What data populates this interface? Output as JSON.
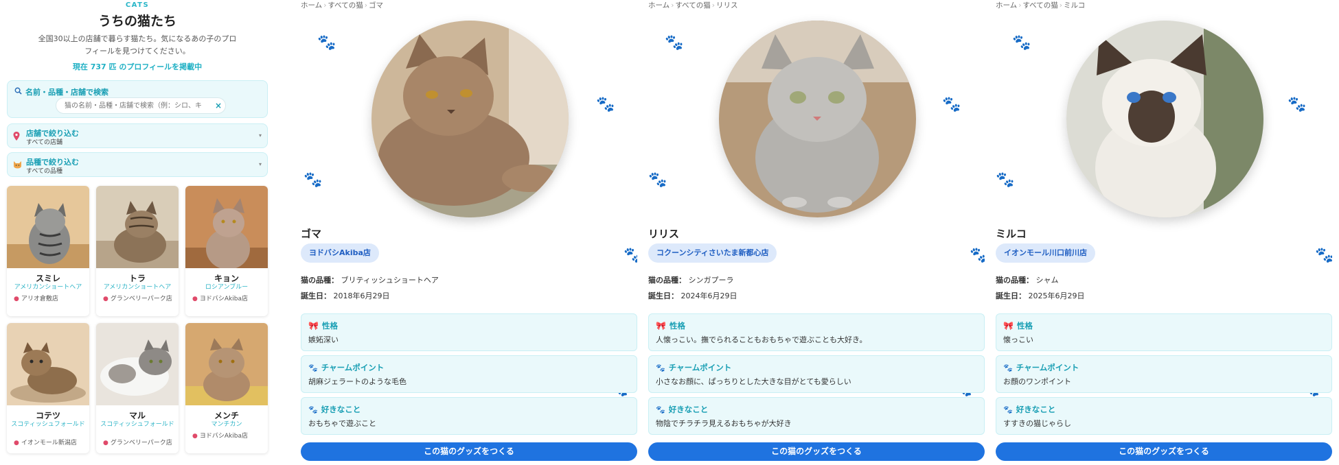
{
  "list": {
    "eyebrow": "CATS",
    "title": "うちの猫たち",
    "description": "全国30以上の店舗で暮らす猫たち。気になるあの子のプロフィールを見つけてください。",
    "count_text": "現在 737 匹 のプロフィールを掲載中",
    "search": {
      "label": "名前・品種・店舗で検索",
      "placeholder": "猫の名前・品種・店舗で検索（例：シロ、キ"
    },
    "store_filter": {
      "label": "店舗で絞り込む",
      "value": "すべての店舗"
    },
    "breed_filter": {
      "label": "品種で絞り込む",
      "value": "すべての品種"
    },
    "cats": [
      {
        "name": "スミレ",
        "breed": "アメリカンショートヘア",
        "store": "アリオ倉敷店"
      },
      {
        "name": "トラ",
        "breed": "アメリカンショートヘア",
        "store": "グランベリーパーク店"
      },
      {
        "name": "キョン",
        "breed": "ロシアンブルー",
        "store": "ヨドバシAkiba店"
      },
      {
        "name": "コテツ",
        "breed": "スコティッシュフォールド",
        "store": "イオンモール新潟店"
      },
      {
        "name": "マル",
        "breed": "スコティッシュフォールド",
        "store": "グランベリーパーク店"
      },
      {
        "name": "メンチ",
        "breed": "マンチカン",
        "store": "ヨドバシAkiba店"
      }
    ]
  },
  "details": [
    {
      "breadcrumb": [
        "ホーム",
        "すべての猫",
        "ゴマ"
      ],
      "name": "ゴマ",
      "store": "ヨドバシAkiba店",
      "breed_label": "猫の品種：",
      "breed": "ブリティッシュショートヘア",
      "birthday_label": "誕生日：",
      "birthday": "2018年6月29日",
      "personality_title": "性格",
      "personality": "嫉妬深い",
      "charm_title": "チャームポイント",
      "charm": "胡麻ジェラートのような毛色",
      "likes_title": "好きなこと",
      "likes": "おもちゃで遊ぶこと",
      "button": "この猫のグッズをつくる"
    },
    {
      "breadcrumb": [
        "ホーム",
        "すべての猫",
        "リリス"
      ],
      "name": "リリス",
      "store": "コクーンシティさいたま新都心店",
      "breed_label": "猫の品種：",
      "breed": "シンガプーラ",
      "birthday_label": "誕生日：",
      "birthday": "2024年6月29日",
      "personality_title": "性格",
      "personality": "人懐っこい。撫でられることもおもちゃで遊ぶことも大好き。",
      "charm_title": "チャームポイント",
      "charm": "小さなお顔に、ぱっちりとした大きな目がとても愛らしい",
      "likes_title": "好きなこと",
      "likes": "物陰でチラチラ見えるおもちゃが大好き",
      "button": "この猫のグッズをつくる"
    },
    {
      "breadcrumb": [
        "ホーム",
        "すべての猫",
        "ミルコ"
      ],
      "name": "ミルコ",
      "store": "イオンモール川口前川店",
      "breed_label": "猫の品種：",
      "breed": "シャム",
      "birthday_label": "誕生日：",
      "birthday": "2025年6月29日",
      "personality_title": "性格",
      "personality": "懐っこい",
      "charm_title": "チャームポイント",
      "charm": "お顔のワンポイント",
      "likes_title": "好きなこと",
      "likes": "すすきの猫じゃらし",
      "button": "この猫のグッズをつくる"
    }
  ],
  "colors": {
    "accent": "#1fb0c4",
    "section_bg": "#eaf9fb",
    "button": "#1f73e0",
    "store_pill_bg": "#dde9fb",
    "store_pill_text": "#1f5ec2"
  },
  "icons": {
    "search": "search-icon",
    "store_filter": "map-pin-icon",
    "breed_filter": "cat-face-icon",
    "personality": "ribbon-icon",
    "charm": "paw-icon",
    "likes": "paw-icon"
  }
}
